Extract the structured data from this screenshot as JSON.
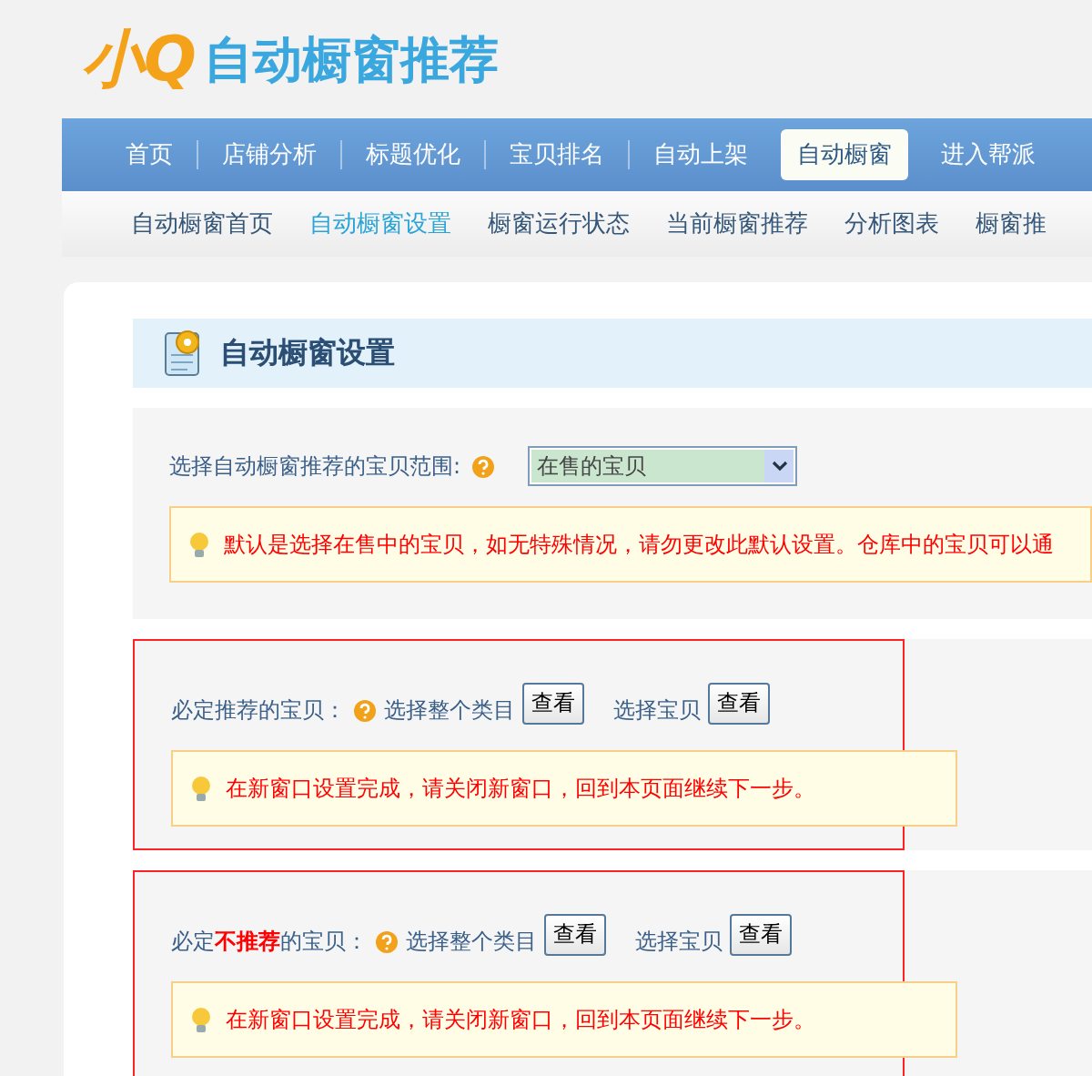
{
  "logo": {
    "mark": "小Q",
    "title": "自动橱窗推荐"
  },
  "nav": [
    {
      "label": "首页",
      "selected": false
    },
    {
      "label": "店铺分析",
      "selected": false
    },
    {
      "label": "标题优化",
      "selected": false
    },
    {
      "label": "宝贝排名",
      "selected": false
    },
    {
      "label": "自动上架",
      "selected": false
    },
    {
      "label": "自动橱窗",
      "selected": true
    },
    {
      "label": "进入帮派",
      "selected": false
    }
  ],
  "subnav": [
    {
      "label": "自动橱窗首页",
      "selected": false
    },
    {
      "label": "自动橱窗设置",
      "selected": true
    },
    {
      "label": "橱窗运行状态",
      "selected": false
    },
    {
      "label": "当前橱窗推荐",
      "selected": false
    },
    {
      "label": "分析图表",
      "selected": false
    },
    {
      "label": "橱窗推",
      "selected": false
    }
  ],
  "page_title": "自动橱窗设置",
  "range": {
    "label": "选择自动橱窗推荐的宝贝范围:",
    "value": "在售的宝贝",
    "tip": "默认是选择在售中的宝贝，如无特殊情况，请勿更改此默认设置。仓库中的宝贝可以通"
  },
  "sections": [
    {
      "label": "必定推荐的宝贝：",
      "category_label": "选择整个类目",
      "category_button": "查看",
      "item_label": "选择宝贝",
      "item_button": "查看",
      "tip": "在新窗口设置完成，请关闭新窗口，回到本页面继续下一步。",
      "highlighted": true
    },
    {
      "label": "必定**不推荐**的宝贝：",
      "category_label": "选择整个类目",
      "category_button": "查看",
      "item_label": "选择宝贝",
      "item_button": "查看",
      "tip": "在新窗口设置完成，请关闭新窗口，回到本页面继续下一步。",
      "highlighted": true
    }
  ]
}
